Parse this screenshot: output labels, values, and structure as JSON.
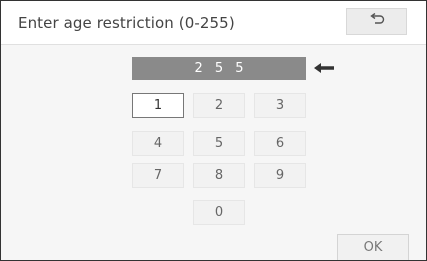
{
  "header": {
    "title": "Enter age restriction (0-255)",
    "back_icon": "return-arrow-icon"
  },
  "entry": {
    "value": "2 5 5",
    "backspace_icon": "left-arrow-backspace-icon"
  },
  "keypad": {
    "keys": [
      "1",
      "2",
      "3",
      "4",
      "5",
      "6",
      "7",
      "8",
      "9",
      "0"
    ],
    "selected_key": "1"
  },
  "footer": {
    "ok_label": "OK"
  }
}
